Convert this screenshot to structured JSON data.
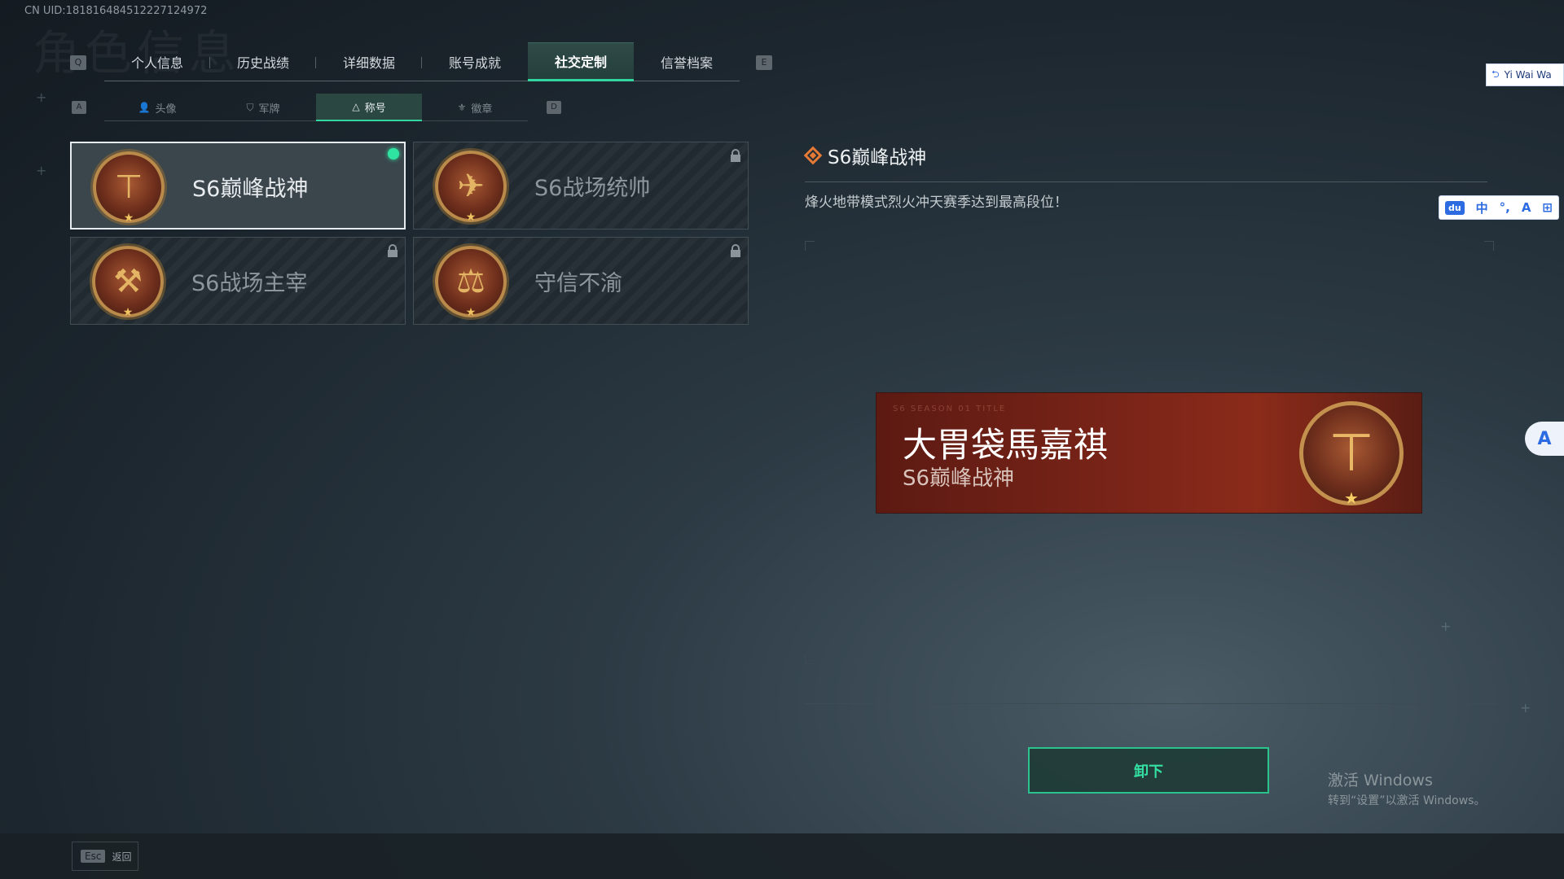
{
  "uid": "CN UID:181816484512227124972",
  "bg_title": "角色信息",
  "top_nav": {
    "prev_key": "Q",
    "next_key": "E",
    "tabs": [
      {
        "label": "个人信息",
        "active": false
      },
      {
        "label": "历史战绩",
        "active": false
      },
      {
        "label": "详细数据",
        "active": false
      },
      {
        "label": "账号成就",
        "active": false
      },
      {
        "label": "社交定制",
        "active": true
      },
      {
        "label": "信誉档案",
        "active": false
      }
    ]
  },
  "sub_nav": {
    "prev_key": "A",
    "next_key": "D",
    "tabs": [
      {
        "label": "头像",
        "icon": "person-icon",
        "active": false
      },
      {
        "label": "军牌",
        "icon": "dogtag-icon",
        "active": false
      },
      {
        "label": "称号",
        "icon": "title-icon",
        "active": true
      },
      {
        "label": "徽章",
        "icon": "badge-icon",
        "active": false
      }
    ]
  },
  "titles": [
    {
      "name": "S6巅峰战神",
      "emblem": "hammer-emblem",
      "locked": false,
      "equipped": true,
      "selected": true
    },
    {
      "name": "S6战场统帅",
      "emblem": "jet-emblem",
      "locked": true,
      "equipped": false,
      "selected": false
    },
    {
      "name": "S6战场主宰",
      "emblem": "hammers-emblem",
      "locked": true,
      "equipped": false,
      "selected": false
    },
    {
      "name": "守信不渝",
      "emblem": "scales-emblem",
      "locked": true,
      "equipped": false,
      "selected": false
    }
  ],
  "detail": {
    "title": "S6巅峰战神",
    "description": "烽火地带模式烈火冲天赛季达到最高段位！"
  },
  "banner": {
    "player_name": "大胃袋馬嘉祺",
    "title": "S6巅峰战神",
    "small_text": "S6 SEASON   01 TITLE"
  },
  "actions": {
    "unequip_label": "卸下",
    "back_key": "Esc",
    "back_label": "返回"
  },
  "windows_activation": {
    "line1": "激活 Windows",
    "line2": "转到“设置”以激活 Windows。"
  },
  "overlays": {
    "yiwai_label": "Yi Wai Wa",
    "ime_items": [
      "du",
      "中",
      "°,",
      "A",
      "⊞"
    ]
  },
  "colors": {
    "accent_green": "#33d6a0",
    "accent_orange": "#e47a35",
    "banner_red": "#7a2418"
  }
}
